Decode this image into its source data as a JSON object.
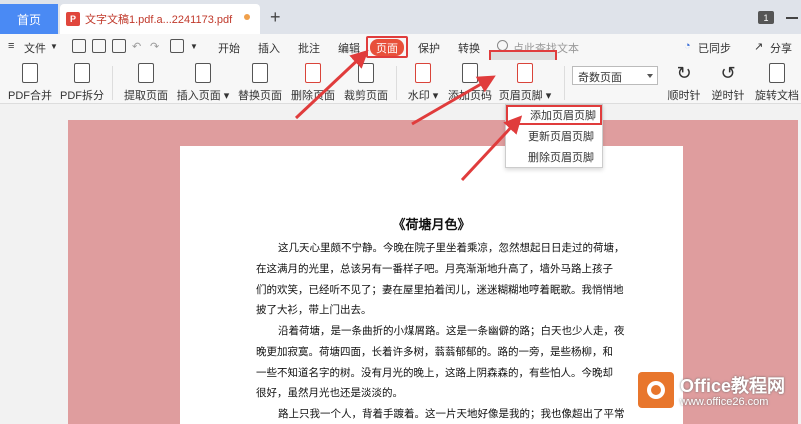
{
  "tabs": {
    "home": "首页",
    "doc_title": "文字文稿1.pdf.a...2241173.pdf",
    "window_count": "1"
  },
  "menu": {
    "file": "文件",
    "items": [
      "开始",
      "插入",
      "批注",
      "编辑",
      "页面",
      "保护",
      "转换"
    ],
    "search_placeholder": "点此查找文本",
    "sync": "已同步",
    "share": "分享"
  },
  "toolbar": {
    "pdf_merge": "PDF合并",
    "pdf_split": "PDF拆分",
    "extract_page": "提取页面",
    "insert_page": "插入页面",
    "replace_page": "替换页面",
    "delete_page": "删除页面",
    "crop_page": "裁剪页面",
    "watermark": "水印",
    "add_page_number": "添加页码",
    "header_footer": "页眉页脚",
    "odd_page": "奇数页面",
    "rotate_cw": "顺时针",
    "rotate_ccw": "逆时针",
    "rotate_doc": "旋转文档"
  },
  "dropdown": [
    "添加页眉页脚",
    "更新页眉页脚",
    "删除页眉页脚"
  ],
  "document": {
    "title": "《荷塘月色》",
    "lines": [
      "这几天心里颇不宁静。今晚在院子里坐着乘凉，忽然想起日日走过的荷塘，",
      "在这满月的光里，总该另有一番样子吧。月亮渐渐地升高了，墙外马路上孩子",
      "们的欢笑，已经听不见了；妻在屋里拍着闰儿，迷迷糊糊地哼着眠歌。我悄悄地",
      "披了大衫，带上门出去。",
      "沿着荷塘，是一条曲折的小煤屑路。这是一条幽僻的路；白天也少人走，夜",
      "晚更加寂寞。荷塘四面，长着许多树，蓊蓊郁郁的。路的一旁，是些杨柳，和",
      "一些不知道名字的树。没有月光的晚上，这路上阴森森的，有些怕人。今晚却",
      "很好，虽然月光也还是淡淡的。",
      "路上只我一个人，背着手踱着。这一片天地好像是我的；我也像超出了平常"
    ]
  },
  "watermark": {
    "title": "Office教程网",
    "url": "www.office26.com"
  }
}
